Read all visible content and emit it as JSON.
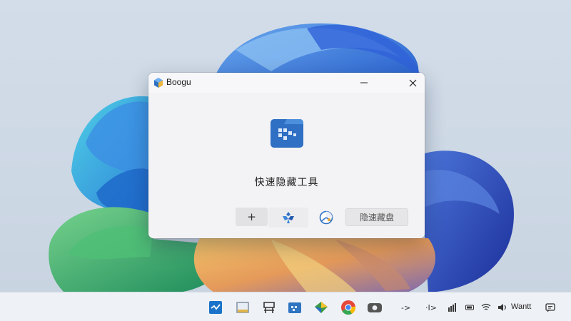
{
  "window": {
    "title": "Boogu",
    "app_name": "快速隐藏工具",
    "hide_button_label": "隐速藏盘",
    "plus_label": "+",
    "controls": {
      "minimize": "—",
      "maximize": "☐",
      "close": "✕"
    }
  },
  "taskbar": {
    "apps": [
      {
        "name": "snip-tool-icon",
        "color": "#1a73c9"
      },
      {
        "name": "image-viewer-icon",
        "color": "#c9a44a"
      },
      {
        "name": "terminal-icon",
        "color": "#333333"
      },
      {
        "name": "folder-app-icon",
        "color": "#2f74c0"
      },
      {
        "name": "store-icon",
        "color": "#3b9a43"
      },
      {
        "name": "chrome-icon",
        "color": "#e5483a"
      },
      {
        "name": "camera-icon",
        "color": "#444444"
      }
    ],
    "tray": {
      "arrow_right": "->",
      "arrow_pipe": "·I>",
      "clock_text": "Wantt"
    }
  },
  "colors": {
    "window_bg": "#f4f4f6",
    "accent_blue": "#2f6fc4",
    "taskbar_bg": "#eef1f6"
  }
}
